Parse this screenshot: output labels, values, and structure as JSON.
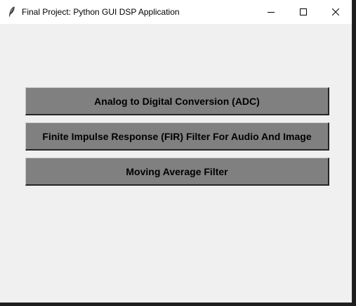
{
  "window": {
    "title": "Final Project: Python GUI DSP Application",
    "icon": "feather-icon",
    "controls": [
      "minimize-icon",
      "maximize-icon",
      "close-icon"
    ]
  },
  "buttons": [
    {
      "label": "Analog to Digital Conversion (ADC)"
    },
    {
      "label": "Finite Impulse Response (FIR) Filter For Audio And Image"
    },
    {
      "label": "Moving Average Filter"
    }
  ],
  "colors": {
    "button_face": "#808080",
    "window_bg": "#f0f0f0",
    "titlebar_bg": "#ffffff",
    "desktop_bg": "#1e1e1e"
  }
}
